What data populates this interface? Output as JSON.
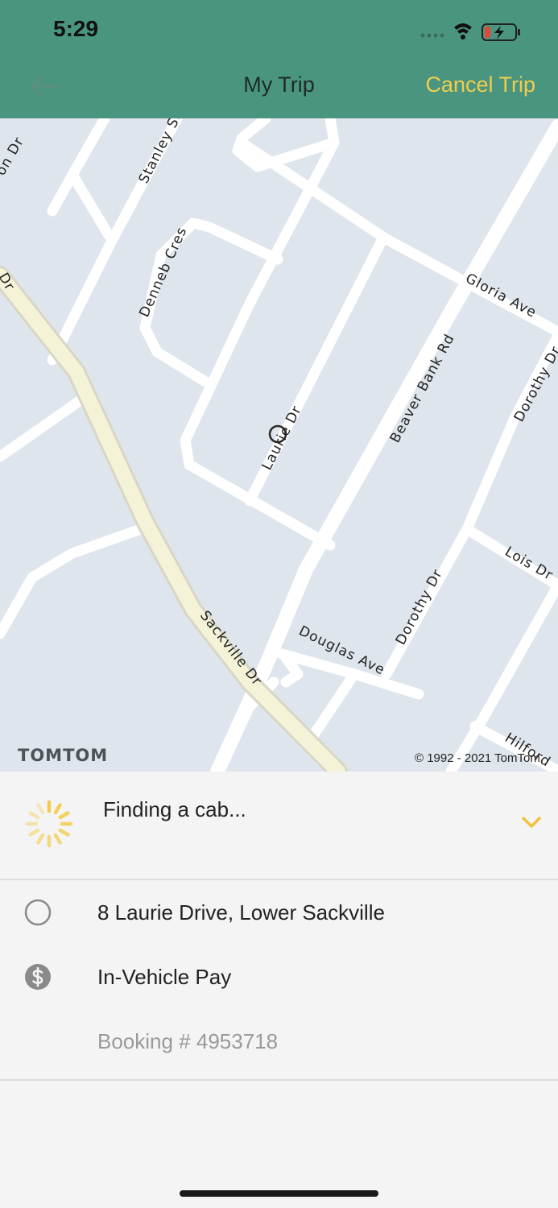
{
  "status_bar": {
    "time": "5:29"
  },
  "nav": {
    "title": "My Trip",
    "cancel_label": "Cancel Trip"
  },
  "map": {
    "streets": [
      "Stanley St",
      "Denneb Cres",
      "Gloria Ave",
      "Laurie Dr",
      "Beaver Bank Rd",
      "Dorothy Dr",
      "Dorothy Dr",
      "Lois Dr",
      "Sackville Dr",
      "Douglas Ave",
      "Hilford"
    ],
    "edge_labels": [
      "on Dr",
      "Dr"
    ],
    "provider_logo": "TOMTOM",
    "copyright": "© 1992 - 2021 TomTom."
  },
  "trip": {
    "status": "Finding a cab...",
    "pickup_address": "8 Laurie Drive, Lower Sackville",
    "payment": "In-Vehicle Pay",
    "booking": "Booking # 4953718"
  },
  "colors": {
    "header": "#4a9580",
    "accent": "#f2cd4c",
    "map_bg": "#dfe5ec"
  }
}
